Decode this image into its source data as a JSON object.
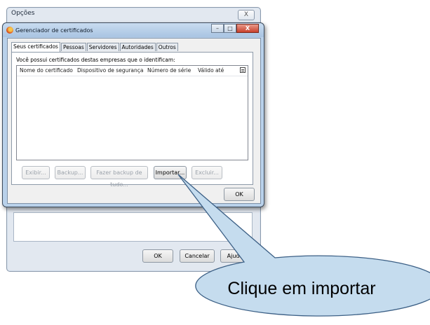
{
  "options_dialog": {
    "title": "Opções",
    "close_label": "X",
    "buttons": {
      "ok": "OK",
      "cancel": "Cancelar",
      "help": "Ajuda"
    }
  },
  "cert_manager": {
    "title": "Gerenciador de certificados",
    "window_buttons": {
      "minimize": "–",
      "maximize": "□",
      "close": "X"
    },
    "tabs": [
      "Seus certificados",
      "Pessoas",
      "Servidores",
      "Autoridades",
      "Outros"
    ],
    "active_tab": "Seus certificados",
    "description": "Você possui certificados destas empresas que o identificam:",
    "columns": [
      "Nome do certificado",
      "Dispositivo de segurança",
      "Número de série",
      "Válido até"
    ],
    "buttons": {
      "view": "Exibir...",
      "backup": "Backup...",
      "backup_all": "Fazer backup de tudo...",
      "import": "Importar...",
      "delete": "Excluir..."
    },
    "ok_label": "OK"
  },
  "callout": {
    "text": "Clique em importar",
    "fill": "#c5dcee",
    "stroke": "#3b5f85"
  }
}
